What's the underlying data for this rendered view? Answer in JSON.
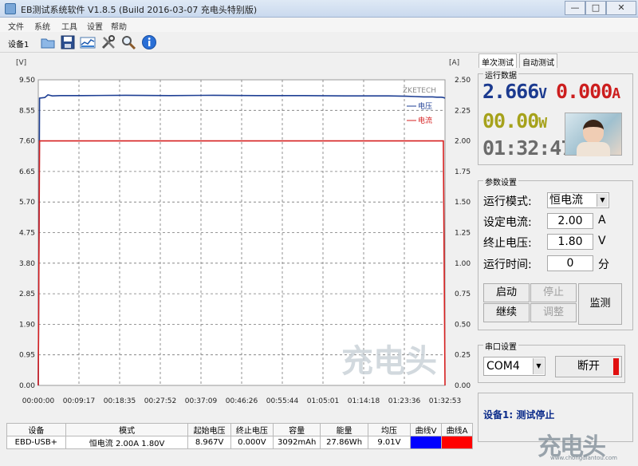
{
  "window": {
    "title": "EB测试系统软件 V1.8.5 (Build 2016-03-07 充电头特别版)",
    "controls": {
      "minimize": "—",
      "maximize": "□",
      "close": "✕"
    }
  },
  "menu": [
    "文件",
    "系统",
    "工具",
    "设置",
    "帮助"
  ],
  "toolbar": {
    "device_tab": "设备1",
    "icons": [
      "folder-icon",
      "save-icon",
      "chart-icon",
      "tools-icon",
      "zoom-icon",
      "info-icon"
    ]
  },
  "chart": {
    "left_unit": "[V]",
    "right_unit": "[A]",
    "brand": "ZKETECH",
    "legend": [
      {
        "label": "电压",
        "color": "#1e3f94"
      },
      {
        "label": "电流",
        "color": "#d62020"
      }
    ],
    "watermark": "充电头"
  },
  "chart_data": {
    "type": "line",
    "x_ticks": [
      "00:00:00",
      "00:09:17",
      "00:18:35",
      "00:27:52",
      "00:37:09",
      "00:46:26",
      "00:55:44",
      "01:05:01",
      "01:14:18",
      "01:23:36",
      "01:32:53"
    ],
    "y_left_ticks": [
      "9.50",
      "8.55",
      "7.60",
      "6.65",
      "5.70",
      "4.75",
      "3.80",
      "2.85",
      "1.90",
      "0.95",
      "0.00"
    ],
    "y_right_ticks": [
      "2.50",
      "2.25",
      "2.00",
      "1.75",
      "1.50",
      "1.25",
      "1.00",
      "0.75",
      "0.50",
      "0.25",
      "0.00"
    ],
    "ylim_left": [
      0,
      9.5
    ],
    "ylim_right": [
      0,
      2.5
    ],
    "xlim_minutes": [
      0,
      92.88
    ],
    "series": [
      {
        "name": "电压",
        "axis": "left",
        "color": "#1e3f94",
        "x": [
          0,
          0.3,
          1.5,
          2.2,
          3.2,
          5,
          10,
          20,
          30,
          40,
          50,
          60,
          70,
          80,
          84,
          86,
          88,
          90,
          91,
          92,
          92.5,
          92.88
        ],
        "y": [
          0,
          8.93,
          8.95,
          9.03,
          9.0,
          9.01,
          9.01,
          9.02,
          9.01,
          9.02,
          9.01,
          9.01,
          9.0,
          9.0,
          8.99,
          8.98,
          8.97,
          8.97,
          8.96,
          8.96,
          8.95,
          8.93
        ]
      },
      {
        "name": "电流",
        "axis": "right",
        "color": "#d62020",
        "x": [
          0,
          0.3,
          92.5,
          92.88
        ],
        "y": [
          0,
          2.0,
          2.0,
          0
        ]
      }
    ]
  },
  "table": {
    "headers": [
      "设备",
      "模式",
      "起始电压",
      "终止电压",
      "容量",
      "能量",
      "均压",
      "曲线V",
      "曲线A"
    ],
    "row": [
      "EBD-USB+",
      "恒电流  2.00A  1.80V",
      "8.967V",
      "0.000V",
      "3092mAh",
      "27.86Wh",
      "9.01V"
    ],
    "curve_v_color": "#0000ff",
    "curve_a_color": "#ff0000"
  },
  "right": {
    "tabs": [
      "单次测试",
      "自动测试"
    ],
    "run_group": "运行数据",
    "voltage": "2.666",
    "voltage_unit": "V",
    "current": "0.000",
    "current_unit": "A",
    "power": "00.00",
    "power_unit": "W",
    "time": "01:32:47",
    "params_group": "参数设置",
    "mode_label": "运行模式:",
    "mode_value": "恒电流",
    "current_label": "设定电流:",
    "current_value": "2.00",
    "current_set_unit": "A",
    "stop_label": "终止电压:",
    "stop_value": "1.80",
    "stop_unit": "V",
    "runtime_label": "运行时间:",
    "runtime_value": "0",
    "runtime_unit": "分",
    "buttons": {
      "start": "启动",
      "stop": "停止",
      "continue": "继续",
      "adjust": "调整",
      "monitor": "监测"
    },
    "port_group": "串口设置",
    "port_value": "COM4",
    "disconnect": "断开",
    "status": "设备1: 测试停止"
  },
  "watermark_corner": "充电头",
  "watermark_url": "www.chongdiantou.com"
}
